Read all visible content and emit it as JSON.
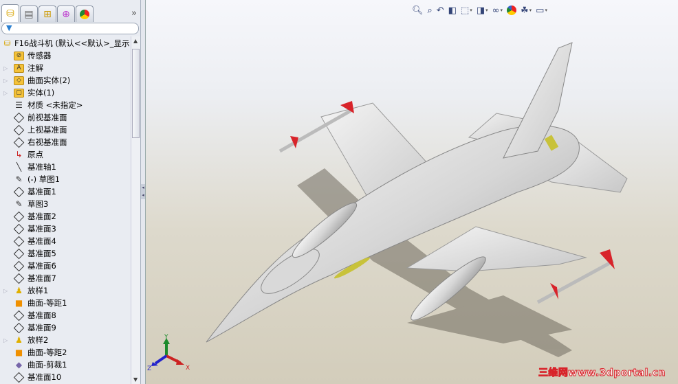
{
  "panel": {
    "tabs": [
      "feature-manager",
      "property-manager",
      "configuration-manager",
      "dimxpert-manager",
      "display-manager"
    ],
    "more_label": "»",
    "filter_icon": "filter-icon",
    "tree": [
      {
        "label": "F16战斗机 (默认<<默认>_显示",
        "icon": "part-icon",
        "exp": false
      },
      {
        "label": "传感器",
        "icon": "sensor-folder-icon",
        "exp": false
      },
      {
        "label": "注解",
        "icon": "annotation-folder-icon",
        "exp": true
      },
      {
        "label": "曲面实体(2)",
        "icon": "surface-bodies-folder-icon",
        "exp": true
      },
      {
        "label": "实体(1)",
        "icon": "solid-bodies-folder-icon",
        "exp": true
      },
      {
        "label": "材质 <未指定>",
        "icon": "material-icon",
        "exp": false
      },
      {
        "label": "前视基准面",
        "icon": "plane-icon",
        "exp": false
      },
      {
        "label": "上视基准面",
        "icon": "plane-icon",
        "exp": false
      },
      {
        "label": "右视基准面",
        "icon": "plane-icon",
        "exp": false
      },
      {
        "label": "原点",
        "icon": "origin-icon",
        "exp": false
      },
      {
        "label": "基准轴1",
        "icon": "axis-icon",
        "exp": false
      },
      {
        "label": "(-) 草图1",
        "icon": "sketch-icon",
        "exp": false
      },
      {
        "label": "基准面1",
        "icon": "plane-icon",
        "exp": false
      },
      {
        "label": "草图3",
        "icon": "sketch-icon",
        "exp": false
      },
      {
        "label": "基准面2",
        "icon": "plane-icon",
        "exp": false
      },
      {
        "label": "基准面3",
        "icon": "plane-icon",
        "exp": false
      },
      {
        "label": "基准面4",
        "icon": "plane-icon",
        "exp": false
      },
      {
        "label": "基准面5",
        "icon": "plane-icon",
        "exp": false
      },
      {
        "label": "基准面6",
        "icon": "plane-icon",
        "exp": false
      },
      {
        "label": "基准面7",
        "icon": "plane-icon",
        "exp": false
      },
      {
        "label": "放样1",
        "icon": "loft-icon",
        "exp": true
      },
      {
        "label": "曲面-等距1",
        "icon": "offset-surface-icon",
        "exp": false
      },
      {
        "label": "基准面8",
        "icon": "plane-icon",
        "exp": false
      },
      {
        "label": "基准面9",
        "icon": "plane-icon",
        "exp": false
      },
      {
        "label": "放样2",
        "icon": "loft-icon",
        "exp": true
      },
      {
        "label": "曲面-等距2",
        "icon": "offset-surface-icon",
        "exp": false
      },
      {
        "label": "曲面-剪裁1",
        "icon": "trim-surface-icon",
        "exp": false
      },
      {
        "label": "基准面10",
        "icon": "plane-icon",
        "exp": false
      }
    ]
  },
  "viewport": {
    "toolbar": [
      "zoom-to-fit-icon",
      "zoom-to-area-icon",
      "previous-view-icon",
      "section-view-icon",
      "view-orientation-icon",
      "display-style-icon",
      "hide-show-items-icon",
      "edit-appearance-icon",
      "apply-scene-icon",
      "view-settings-icon"
    ],
    "triad": {
      "x": "X",
      "y": "Y",
      "z": "Z"
    },
    "watermark": "三维网www.3dportal.cn"
  }
}
